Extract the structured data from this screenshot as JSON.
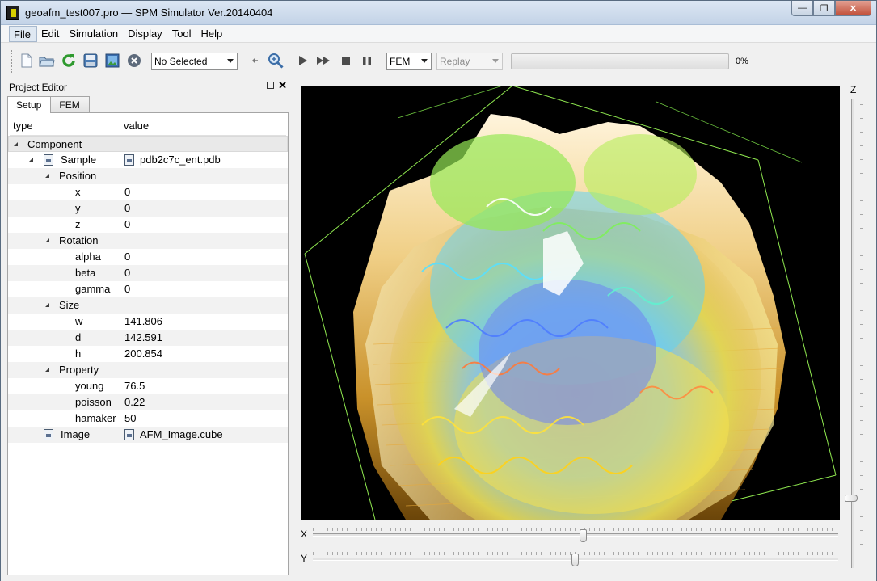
{
  "window": {
    "title": "geoafm_test007.pro — SPM Simulator Ver.20140404",
    "minimize": "—",
    "maximize": "❐",
    "close": "✕"
  },
  "menu": [
    "File",
    "Edit",
    "Simulation",
    "Display",
    "Tool",
    "Help"
  ],
  "toolbar": {
    "selection_combo": "No Selected",
    "mode_combo": "FEM",
    "replay_combo": "Replay",
    "progress_text": "0%",
    "progress_value": 0
  },
  "panel": {
    "title": "Project Editor",
    "tabs": [
      "Setup",
      "FEM"
    ],
    "col_type": "type",
    "col_value": "value",
    "component_label": "Component",
    "rows": [
      {
        "label": "Sample",
        "value": "pdb2c7c_ent.pdb"
      },
      {
        "label": "Position",
        "value": ""
      },
      {
        "label": "x",
        "value": "0"
      },
      {
        "label": "y",
        "value": "0"
      },
      {
        "label": "z",
        "value": "0"
      },
      {
        "label": "Rotation",
        "value": ""
      },
      {
        "label": "alpha",
        "value": "0"
      },
      {
        "label": "beta",
        "value": "0"
      },
      {
        "label": "gamma",
        "value": "0"
      },
      {
        "label": "Size",
        "value": ""
      },
      {
        "label": "w",
        "value": "141.806"
      },
      {
        "label": "d",
        "value": "142.591"
      },
      {
        "label": "h",
        "value": "200.854"
      },
      {
        "label": "Property",
        "value": ""
      },
      {
        "label": "young",
        "value": "76.5"
      },
      {
        "label": "poisson",
        "value": "0.22"
      },
      {
        "label": "hamaker",
        "value": "50"
      },
      {
        "label": "Image",
        "value": "AFM_Image.cube"
      }
    ]
  },
  "sliders": {
    "x_label": "X",
    "y_label": "Y",
    "z_label": "Z"
  }
}
